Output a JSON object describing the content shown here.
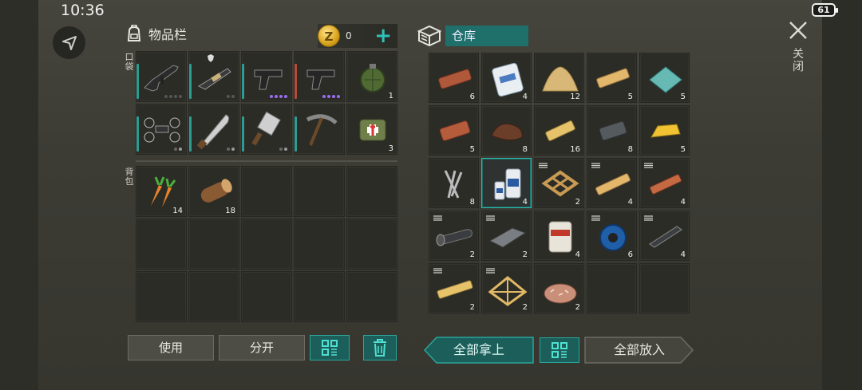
{
  "status_bar": {
    "time": "10:36",
    "battery": "61"
  },
  "inventory": {
    "title": "物品栏",
    "coins": "0",
    "pocket_label": "口袋",
    "backpack_label": "背包",
    "pocket_slots": [
      {
        "item": "assault-rifle",
        "count": "",
        "bar": "#2e9c92",
        "dots": [
          "#555",
          "#555",
          "#555",
          "#555"
        ]
      },
      {
        "item": "shotgun",
        "count": "",
        "bar": "#2e9c92",
        "dots": [
          "#555",
          "#555"
        ],
        "shield": true
      },
      {
        "item": "pistol",
        "count": "",
        "bar": "#2e9c92",
        "dots": [
          "#9b6df0",
          "#9b6df0",
          "#9b6df0",
          "#9b6df0"
        ]
      },
      {
        "item": "pistol",
        "count": "",
        "bar": "#b84a3a",
        "dots": [
          "#9b6df0",
          "#9b6df0",
          "#9b6df0",
          "#9b6df0"
        ]
      },
      {
        "item": "grenade",
        "count": "1",
        "bar": "",
        "dots": []
      },
      {
        "item": "drone",
        "count": "",
        "bar": "#2e9c92",
        "dots": [
          "#666",
          "#9a9a9a"
        ]
      },
      {
        "item": "machete",
        "count": "",
        "bar": "#2e9c92",
        "dots": [
          "#666",
          "#9a9a9a"
        ]
      },
      {
        "item": "cleaver",
        "count": "",
        "bar": "#2e9c92",
        "dots": [
          "#666",
          "#9a9a9a"
        ]
      },
      {
        "item": "pickaxe",
        "count": "",
        "bar": "#2e9c92",
        "dots": []
      },
      {
        "item": "medkit-bag",
        "count": "3",
        "bar": "",
        "dots": []
      }
    ],
    "backpack_slots": [
      {
        "item": "carrots",
        "count": "14"
      },
      {
        "item": "log",
        "count": "18"
      },
      {
        "item": "",
        "count": ""
      },
      {
        "item": "",
        "count": ""
      },
      {
        "item": "",
        "count": ""
      },
      {
        "item": "",
        "count": ""
      },
      {
        "item": "",
        "count": ""
      },
      {
        "item": "",
        "count": ""
      },
      {
        "item": "",
        "count": ""
      },
      {
        "item": "",
        "count": ""
      },
      {
        "item": "",
        "count": ""
      },
      {
        "item": "",
        "count": ""
      },
      {
        "item": "",
        "count": ""
      },
      {
        "item": "",
        "count": ""
      },
      {
        "item": "",
        "count": ""
      }
    ],
    "use_label": "使用",
    "split_label": "分开"
  },
  "warehouse": {
    "title": "仓库",
    "slots": [
      {
        "item": "copper-plank",
        "count": "6",
        "tier": false
      },
      {
        "item": "cement-bag",
        "count": "4",
        "tier": false
      },
      {
        "item": "sand-pile",
        "count": "12",
        "tier": false
      },
      {
        "item": "wood-plank",
        "count": "5",
        "tier": false
      },
      {
        "item": "glass-sheet",
        "count": "5",
        "tier": false
      },
      {
        "item": "copper-ingot",
        "count": "5",
        "tier": false
      },
      {
        "item": "leather",
        "count": "8",
        "tier": false
      },
      {
        "item": "wood-block",
        "count": "16",
        "tier": false
      },
      {
        "item": "iron-ingot",
        "count": "8",
        "tier": false
      },
      {
        "item": "gold-bar",
        "count": "5",
        "tier": false
      },
      {
        "item": "nails",
        "count": "8",
        "tier": false
      },
      {
        "item": "resin-bottles",
        "count": "4",
        "tier": false,
        "selected": true
      },
      {
        "item": "wooden-frame",
        "count": "2",
        "tier": true
      },
      {
        "item": "wood-beam",
        "count": "4",
        "tier": true
      },
      {
        "item": "copper-beam",
        "count": "4",
        "tier": true
      },
      {
        "item": "iron-pipe",
        "count": "2",
        "tier": true
      },
      {
        "item": "metal-plate",
        "count": "2",
        "tier": true
      },
      {
        "item": "asbestos-bag",
        "count": "4",
        "tier": false
      },
      {
        "item": "wire-spool",
        "count": "6",
        "tier": true
      },
      {
        "item": "iron-bar",
        "count": "4",
        "tier": true
      },
      {
        "item": "wood-post",
        "count": "2",
        "tier": true
      },
      {
        "item": "wood-truss",
        "count": "2",
        "tier": true
      },
      {
        "item": "wood-chips",
        "count": "2",
        "tier": false
      },
      {
        "item": "",
        "count": ""
      },
      {
        "item": "",
        "count": ""
      }
    ],
    "take_all_label": "全部拿上",
    "put_all_label": "全部放入"
  },
  "close_label": "关闭",
  "colors": {
    "accent": "#2aa69b",
    "selected_border": "#2fb7ab"
  }
}
